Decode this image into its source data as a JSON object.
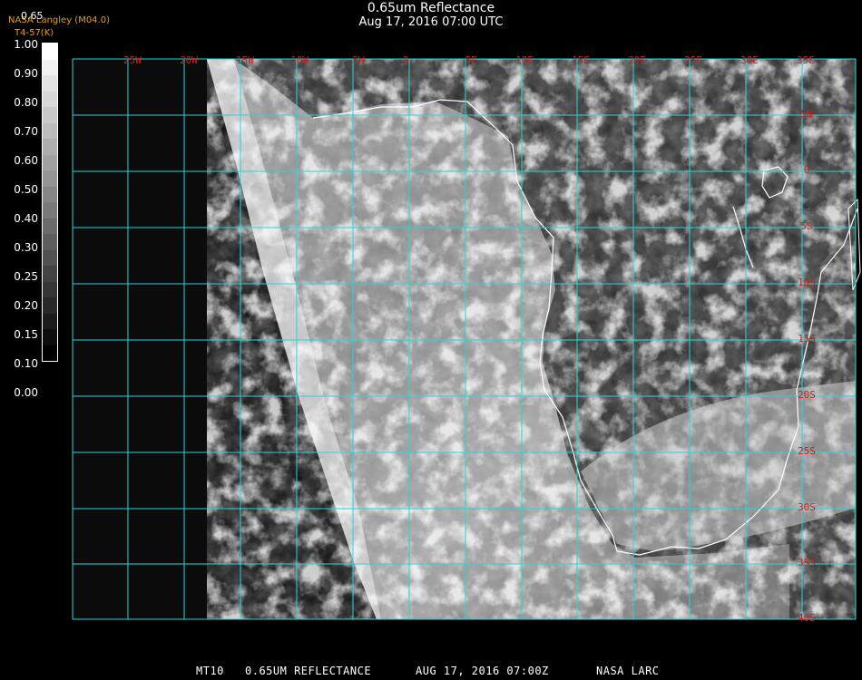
{
  "header": {
    "title": "0.65um Reflectance",
    "subtitle": "Aug 17, 2016 07:00 UTC",
    "credit": "NASA Langley (M04.0)",
    "credit_sub": "T4-57(K)",
    "scale_header": "0.65"
  },
  "colorbar": {
    "labels": [
      "1.00",
      "0.90",
      "0.80",
      "0.70",
      "0.60",
      "0.50",
      "0.40",
      "0.30",
      "0.25",
      "0.20",
      "0.15",
      "0.10",
      "0.00"
    ]
  },
  "map": {
    "longitude_labels": [
      "25W",
      "20W",
      "15W",
      "10W",
      "5W",
      "0",
      "5E",
      "10E",
      "15E",
      "20E",
      "25E",
      "30E",
      "35E"
    ],
    "latitude_labels": [
      "5N",
      "0",
      "5S",
      "10S",
      "15S",
      "20S",
      "25S",
      "30S",
      "35S",
      "40S"
    ],
    "colors": {
      "grid": "#2ad4d4",
      "labels": "#d02020",
      "coast": "#ffffff"
    }
  },
  "footer": {
    "satellite": "MT10",
    "product": "0.65UM REFLECTANCE",
    "datetime": "AUG 17, 2016 07:00Z",
    "source": "NASA LARC"
  }
}
